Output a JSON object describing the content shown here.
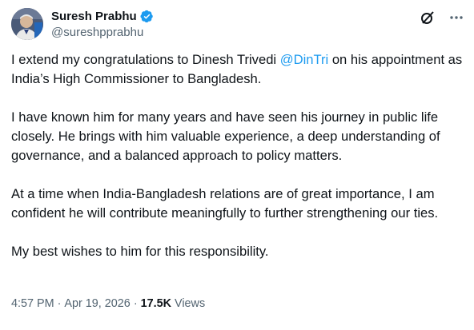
{
  "author": {
    "display_name": "Suresh Prabhu",
    "handle": "@sureshpprabhu",
    "verified": true,
    "verified_color": "#1d9bf0"
  },
  "icons": {
    "avatar": "profile-photo",
    "verified": "verified-badge-icon",
    "grok": "grok-icon",
    "more": "more-options-icon"
  },
  "post": {
    "p1_before": "I extend my congratulations to Dinesh Trivedi ",
    "p1_mention": "@DinTri",
    "p1_after": " on his appointment as India’s High Commissioner to Bangladesh.",
    "p2": "I have known him for many years and have seen his journey in public life closely. He brings with him valuable experience, a deep understanding of governance, and a balanced approach to policy matters.",
    "p3": "At a time when India-Bangladesh relations are of great importance, I am confident he will contribute meaningfully to further strengthening our ties.",
    "p4": "My best wishes to him for this responsibility."
  },
  "meta": {
    "time": "4:57 PM",
    "separator": "·",
    "date": "Apr 19, 2026",
    "views_count": "17.5K",
    "views_label": "Views"
  },
  "colors": {
    "text": "#0f1419",
    "secondary": "#536471",
    "link": "#1d9bf0"
  }
}
